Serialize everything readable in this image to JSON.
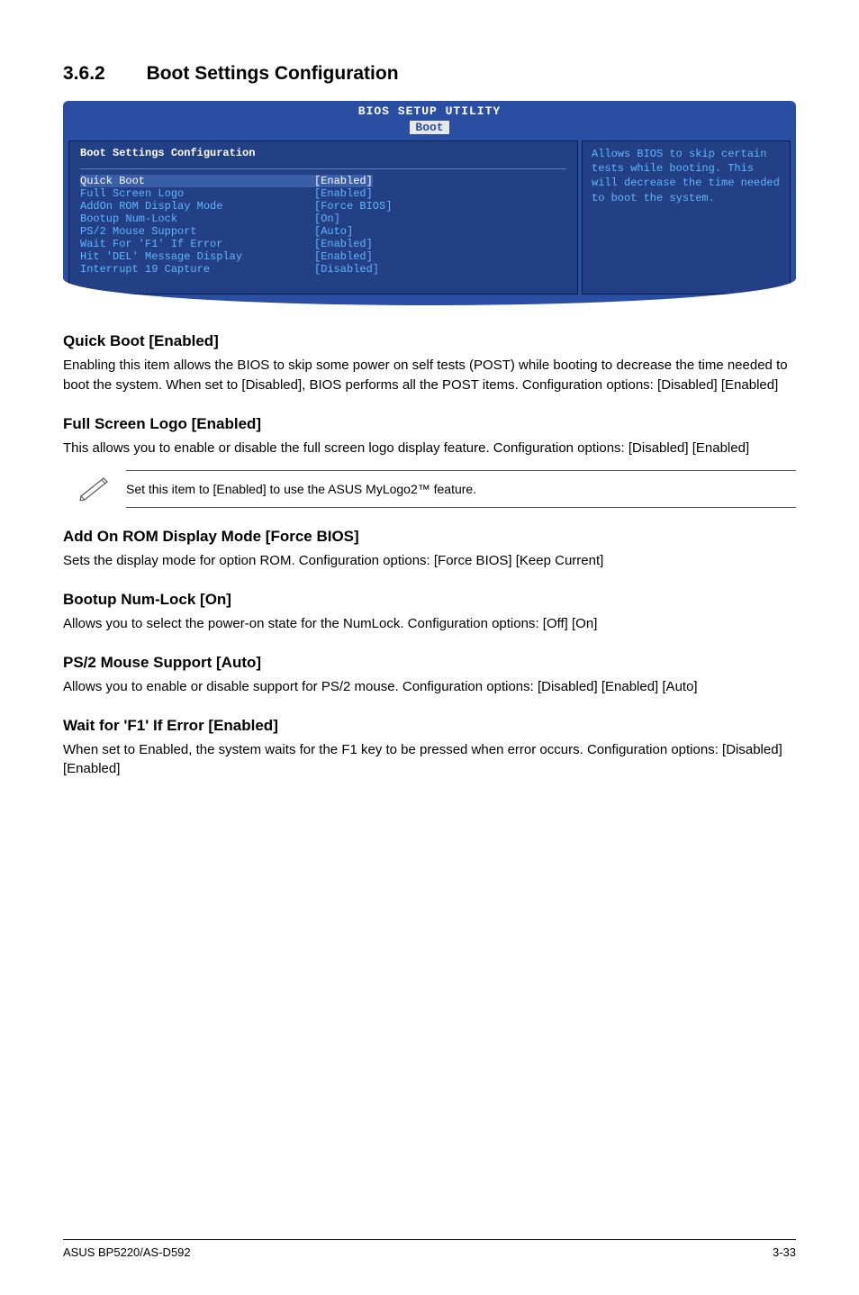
{
  "heading": {
    "number": "3.6.2",
    "title": "Boot Settings Configuration"
  },
  "bios": {
    "title": "BIOS SETUP UTILITY",
    "tab": "Boot",
    "panel_header": "Boot Settings Configuration",
    "rows": [
      {
        "label": "Quick Boot",
        "value": "[Enabled]",
        "highlight": true
      },
      {
        "label": "Full Screen Logo",
        "value": "[Enabled]"
      },
      {
        "label": "AddOn ROM Display Mode",
        "value": "[Force BIOS]"
      },
      {
        "label": "Bootup Num-Lock",
        "value": "[On]"
      },
      {
        "label": "PS/2 Mouse Support",
        "value": "[Auto]"
      },
      {
        "label": "Wait For 'F1' If Error",
        "value": "[Enabled]"
      },
      {
        "label": "Hit 'DEL' Message Display",
        "value": "[Enabled]"
      },
      {
        "label": "Interrupt 19 Capture",
        "value": "[Disabled]"
      }
    ],
    "help": "Allows BIOS to skip certain tests while booting. This will decrease the time needed to boot the system."
  },
  "sections": [
    {
      "title": "Quick Boot [Enabled]",
      "body": "Enabling this item allows the BIOS to skip some power on self tests (POST) while booting to decrease the time needed to boot the system. When set to [Disabled], BIOS performs all the POST items. Configuration options: [Disabled] [Enabled]"
    },
    {
      "title": "Full Screen Logo [Enabled]",
      "body": "This allows you to enable or disable the full screen logo display feature. Configuration options: [Disabled] [Enabled]"
    }
  ],
  "note": "Set this item to [Enabled] to use the ASUS MyLogo2™ feature.",
  "sections2": [
    {
      "title": "Add On ROM Display Mode [Force BIOS]",
      "body": "Sets the display mode for option ROM. Configuration options: [Force BIOS] [Keep Current]"
    },
    {
      "title": "Bootup Num-Lock [On]",
      "body": "Allows you to select the power-on state for the NumLock. Configuration options: [Off] [On]"
    },
    {
      "title": "PS/2 Mouse Support [Auto]",
      "body": "Allows you to enable or disable support for PS/2 mouse. Configuration options: [Disabled] [Enabled] [Auto]"
    },
    {
      "title": "Wait for 'F1' If Error [Enabled]",
      "body": "When set to Enabled, the system waits for the F1 key to be pressed when error occurs. Configuration options: [Disabled] [Enabled]"
    }
  ],
  "footer": {
    "left": "ASUS BP5220/AS-D592",
    "right": "3-33"
  }
}
